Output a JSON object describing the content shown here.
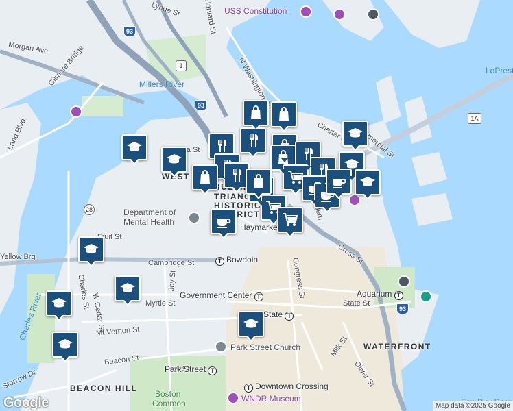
{
  "labels": {
    "areas": {
      "west_end": "WEST",
      "bulfinch_1": "BULFINCH",
      "bulfinch_2": "TRIANGLE",
      "bulfinch_3": "HISTORIC",
      "bulfinch_4": "DISTRICT",
      "waterfront": "WATERFRONT",
      "beacon_hill": "BEACON HILL"
    },
    "streets": {
      "lynde": "Lynde St",
      "harvard": "Harvard St",
      "morgan": "Morgan Ave",
      "gilmore": "Gilmore Bridge",
      "n_washington": "N Washington St",
      "charter": "Charter St",
      "commercial": "Commercial St",
      "cambridge": "Cambridge St",
      "fruit": "Fruit St",
      "charles": "Charles St",
      "w_cedar": "W Cedar St",
      "joy": "Joy St",
      "myrtle": "Myrtle St",
      "mt_vernon": "Mt Vernon St",
      "beacon": "Beacon St",
      "park": "Park St",
      "congress": "Congress St",
      "state": "State St",
      "milk": "Milk St",
      "oliver": "Oliver St",
      "cross": "Cross St",
      "storrow": "Storrow Dr",
      "land_blvd": "Land Blvd",
      "yellow_brg": "Yellow Brg",
      "nashua": "Nashua St",
      "salem": "Salem"
    },
    "water": {
      "millers_river": "Millers River",
      "charles_river": "Charles River",
      "lopresti": "LoPresti",
      "fan_pier": "Fan Pier Park"
    },
    "pois": {
      "uss_constitution": "USS Constitution",
      "dept_mental_health_1": "Department of",
      "dept_mental_health_2": "Mental Health",
      "park_street_church": "Park Street Church",
      "wndr_museum": "WNDR Museum",
      "boston_common_1": "Boston",
      "boston_common_2": "Common"
    },
    "stations": {
      "bowdoin": "Bowdoin",
      "government_center": "Government Center",
      "state": "State",
      "aquarium": "Aquarium",
      "park_street": "Park Street",
      "downtown_crossing": "Downtown Crossing",
      "haymarket": "Haymarket"
    },
    "shields": {
      "us1": "1",
      "i93_north": "93",
      "i93_mid": "93",
      "i93_south": "93",
      "r28": "28",
      "r1a": "1A"
    }
  },
  "transit_symbol": "T",
  "markers": [
    {
      "type": "shopping-bag"
    },
    {
      "type": "shopping-bag"
    },
    {
      "type": "school"
    },
    {
      "type": "school"
    },
    {
      "type": "school"
    },
    {
      "type": "school"
    },
    {
      "type": "school"
    },
    {
      "type": "restaurant"
    },
    {
      "type": "shopping-bag"
    },
    {
      "type": "shopping-bag"
    },
    {
      "type": "restaurant"
    },
    {
      "type": "restaurant"
    },
    {
      "type": "restaurant"
    },
    {
      "type": "restaurant"
    },
    {
      "type": "shopping-bag"
    },
    {
      "type": "shopping-bag"
    },
    {
      "type": "restaurant"
    },
    {
      "type": "coffee"
    },
    {
      "type": "shopping-cart"
    },
    {
      "type": "shopping-cart"
    },
    {
      "type": "shopping-cart"
    },
    {
      "type": "coffee"
    },
    {
      "type": "coffee"
    },
    {
      "type": "school"
    },
    {
      "type": "school"
    },
    {
      "type": "school"
    },
    {
      "type": "school"
    },
    {
      "type": "school"
    },
    {
      "type": "coffee"
    },
    {
      "type": "shopping-bag"
    }
  ],
  "colors": {
    "water": "#aadaff",
    "land": "#e9eef2",
    "park": "#cfe9c8",
    "highway": "#8fa3b8",
    "marker": "#1b4f7e",
    "poi_purple": "#a24dbc",
    "poi_teal": "#1a9e8a"
  },
  "attribution": "Map data ©2025 Google",
  "logo": "Google"
}
